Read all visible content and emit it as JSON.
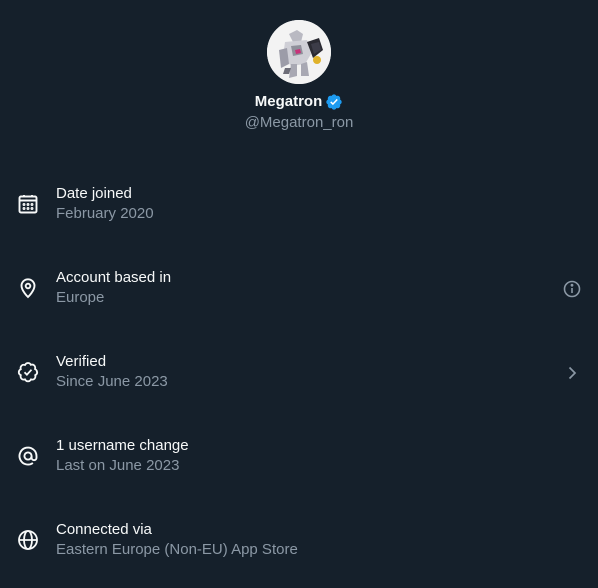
{
  "profile": {
    "display_name": "Megatron",
    "handle": "@Megatron_ron",
    "verified": true,
    "badge_color": "#1d9bf0"
  },
  "rows": [
    {
      "icon": "calendar-icon",
      "title": "Date joined",
      "subtitle": "February 2020"
    },
    {
      "icon": "location-pin-icon",
      "title": "Account based in",
      "subtitle": "Europe",
      "action": "info-icon"
    },
    {
      "icon": "verified-seal-icon",
      "title": "Verified",
      "subtitle": "Since June 2023",
      "action": "chevron-right-icon"
    },
    {
      "icon": "at-sign-icon",
      "title": "1 username change",
      "subtitle": "Last on June 2023"
    },
    {
      "icon": "globe-icon",
      "title": "Connected via",
      "subtitle": "Eastern Europe (Non-EU) App Store"
    }
  ],
  "colors": {
    "background": "#15202b",
    "primary_text": "#f7f9f9",
    "secondary_text": "#8b98a5",
    "accent": "#1d9bf0"
  }
}
